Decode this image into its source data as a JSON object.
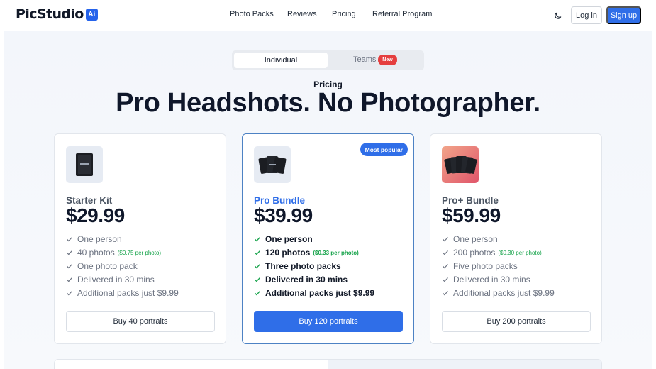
{
  "header": {
    "logo_text": "PicStudio",
    "logo_badge": "Ai",
    "nav": [
      "Photo Packs",
      "Reviews",
      "Pricing",
      "Referral Program"
    ],
    "login_label": "Log in",
    "signup_label": "Sign up",
    "theme_icon": "moon-icon"
  },
  "toggle": {
    "individual_label": "Individual",
    "teams_label": "Teams",
    "new_badge": "New"
  },
  "hero": {
    "eyebrow": "Pricing",
    "headline": "Pro Headshots. No Photographer."
  },
  "plans": [
    {
      "name": "Starter Kit",
      "price": "$29.99",
      "features": [
        {
          "text": "One person"
        },
        {
          "text": "40 photos",
          "per": "($0.75 per photo)"
        },
        {
          "text": "One photo pack"
        },
        {
          "text": "Delivered in 30 mins"
        },
        {
          "text": "Additional packs just $9.99"
        }
      ],
      "button": "Buy 40 portraits"
    },
    {
      "name": "Pro Bundle",
      "price": "$39.99",
      "badge": "Most popular",
      "features": [
        {
          "text": "One person"
        },
        {
          "text": "120 photos",
          "per": "($0.33 per photo)"
        },
        {
          "text": "Three photo packs"
        },
        {
          "text": "Delivered in 30 mins"
        },
        {
          "text": "Additional packs just $9.99"
        }
      ],
      "button": "Buy 120 portraits"
    },
    {
      "name": "Pro+ Bundle",
      "price": "$59.99",
      "features": [
        {
          "text": "One person"
        },
        {
          "text": "200 photos",
          "per": "($0.30 per photo)"
        },
        {
          "text": "Five photo packs"
        },
        {
          "text": "Delivered in 30 mins"
        },
        {
          "text": "Additional packs just $9.99"
        }
      ],
      "button": "Buy 200 portraits"
    }
  ],
  "colors": {
    "accent": "#2f6ee8",
    "new_badge": "#e53e3e",
    "per_photo": "#16a34a"
  }
}
